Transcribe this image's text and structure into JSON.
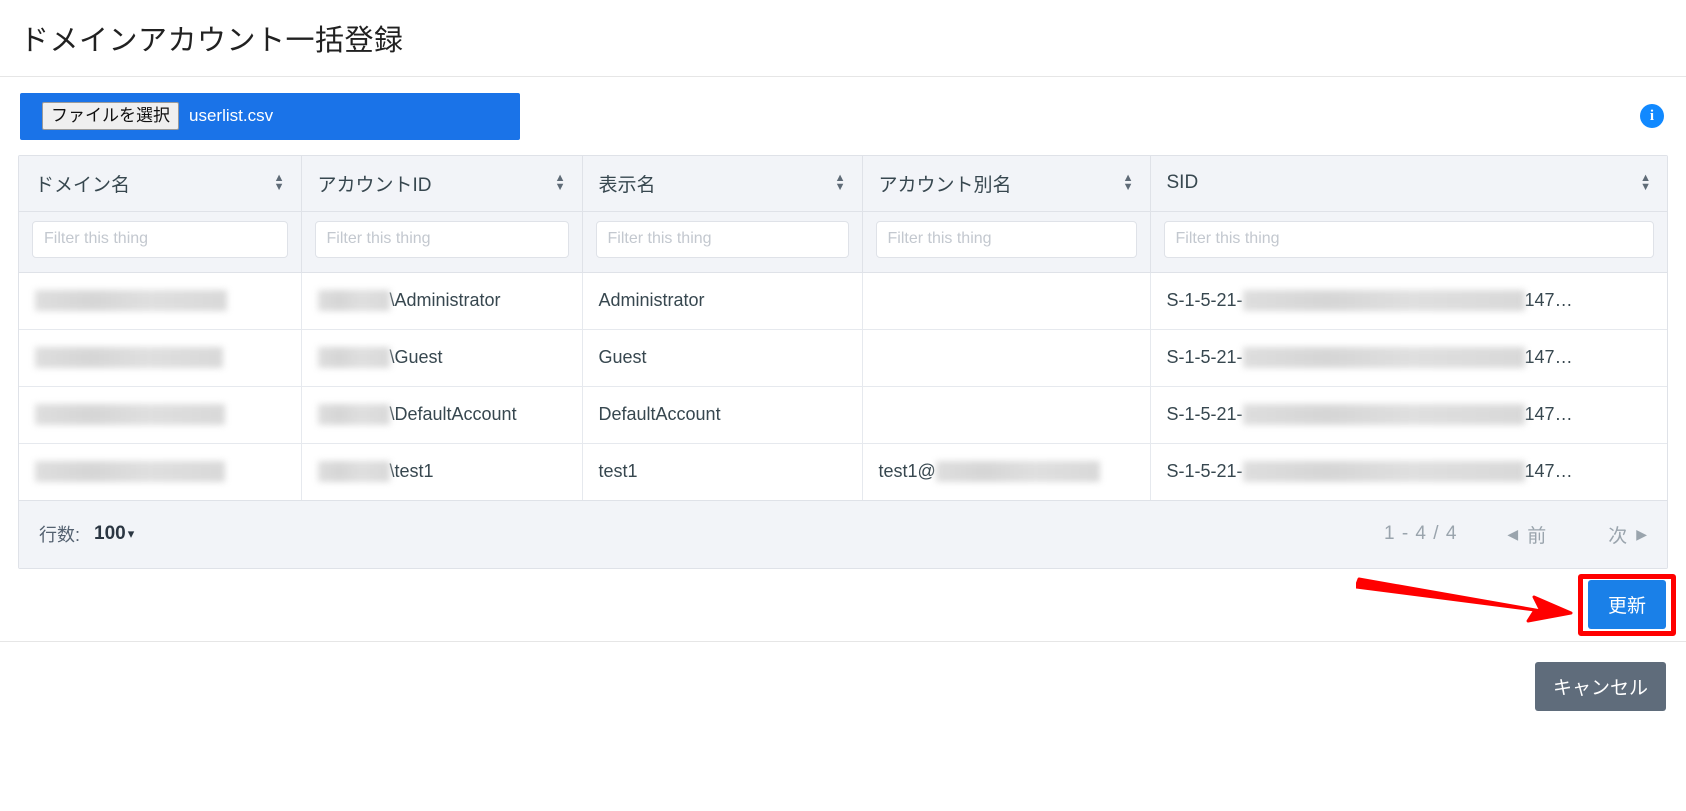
{
  "header": {
    "title": "ドメインアカウント一括登録"
  },
  "file_upload": {
    "choose_button_label": "ファイルを選択",
    "file_name": "userlist.csv",
    "info_icon_label": "i",
    "accent_color": "#1a73e8"
  },
  "table": {
    "columns": [
      {
        "key": "domain",
        "label": "ドメイン名",
        "sortable": true,
        "filter_placeholder": "Filter this thing"
      },
      {
        "key": "account",
        "label": "アカウントID",
        "sortable": true,
        "filter_placeholder": "Filter this thing"
      },
      {
        "key": "display",
        "label": "表示名",
        "sortable": true,
        "filter_placeholder": "Filter this thing"
      },
      {
        "key": "alias",
        "label": "アカウント別名",
        "sortable": true,
        "filter_placeholder": "Filter this thing"
      },
      {
        "key": "sid",
        "label": "SID",
        "sortable": true,
        "filter_placeholder": "Filter this thing"
      }
    ],
    "filter_values": [
      "",
      "",
      "",
      "",
      ""
    ],
    "rows": [
      {
        "domain": "",
        "domain_redacted": true,
        "account": "\\Administrator",
        "account_redacted_prefix": true,
        "display": "Administrator",
        "alias": "",
        "alias_redacted": false,
        "sid": "S-1-5-21-",
        "sid_suffix": "147…",
        "sid_redacted_middle": true
      },
      {
        "domain": "",
        "domain_redacted": true,
        "account": "\\Guest",
        "account_redacted_prefix": true,
        "display": "Guest",
        "alias": "",
        "alias_redacted": false,
        "sid": "S-1-5-21-",
        "sid_suffix": "147…",
        "sid_redacted_middle": true
      },
      {
        "domain": "",
        "domain_redacted": true,
        "account": "\\DefaultAccount",
        "account_redacted_prefix": true,
        "display": "DefaultAccount",
        "alias": "",
        "alias_redacted": false,
        "sid": "S-1-5-21-",
        "sid_suffix": "147…",
        "sid_redacted_middle": true
      },
      {
        "domain": "",
        "domain_redacted": true,
        "account": "\\test1",
        "account_redacted_prefix": true,
        "display": "test1",
        "alias": "test1@",
        "alias_redacted": true,
        "sid": "S-1-5-21-",
        "sid_suffix": "147…",
        "sid_redacted_middle": true
      }
    ]
  },
  "footer": {
    "rows_label": "行数:",
    "rows_value": "100",
    "rows_caret": "▾",
    "page_count": "1 - 4 / 4",
    "prev_arrow": "◀",
    "prev_label": "前",
    "next_label": "次",
    "next_arrow": "▶"
  },
  "actions": {
    "update_label": "更新",
    "cancel_label": "キャンセル",
    "highlight_color": "#ff0000"
  }
}
